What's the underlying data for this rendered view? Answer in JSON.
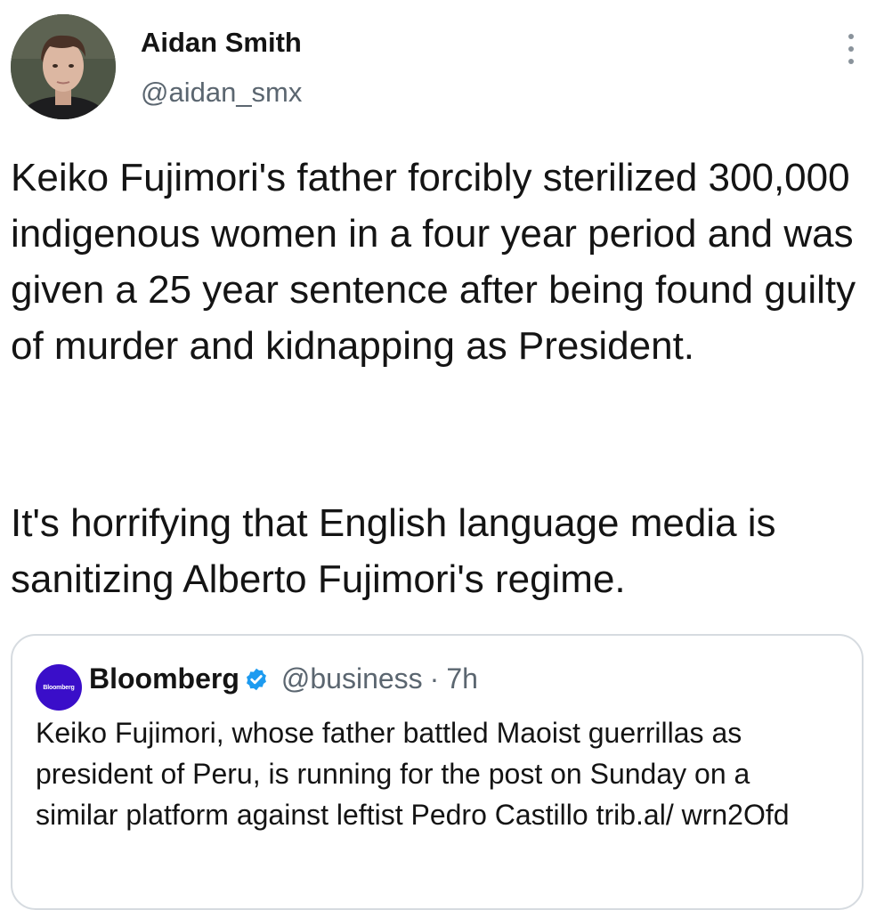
{
  "author": {
    "name": "Aidan Smith",
    "handle": "@aidan_smx"
  },
  "tweet": {
    "paragraph1": "Keiko Fujimori's father forcibly sterilized 300,000 indigenous women in a four year period and was given a 25 year sentence after being found guilty of murder and kidnapping as President.",
    "paragraph2": "It's horrifying that English language media is sanitizing Alberto Fujimori's regime."
  },
  "quote": {
    "logo_text": "Bloomberg",
    "name": "Bloomberg",
    "handle": "@business",
    "separator": "·",
    "time": "7h",
    "text": "Keiko Fujimori, whose father battled Maoist guerrillas as president of Peru, is running for the post on Sunday on a similar platform against leftist Pedro Castillo trib.al/ wrn2Ofd"
  },
  "icons": {
    "more": "more-vertical-icon",
    "verified": "verified-badge-icon"
  },
  "colors": {
    "text": "#141414",
    "secondary": "#5b6670",
    "verified": "#1d9bf0",
    "bloomberg": "#3a0ec9",
    "border": "#d6dbe0"
  }
}
